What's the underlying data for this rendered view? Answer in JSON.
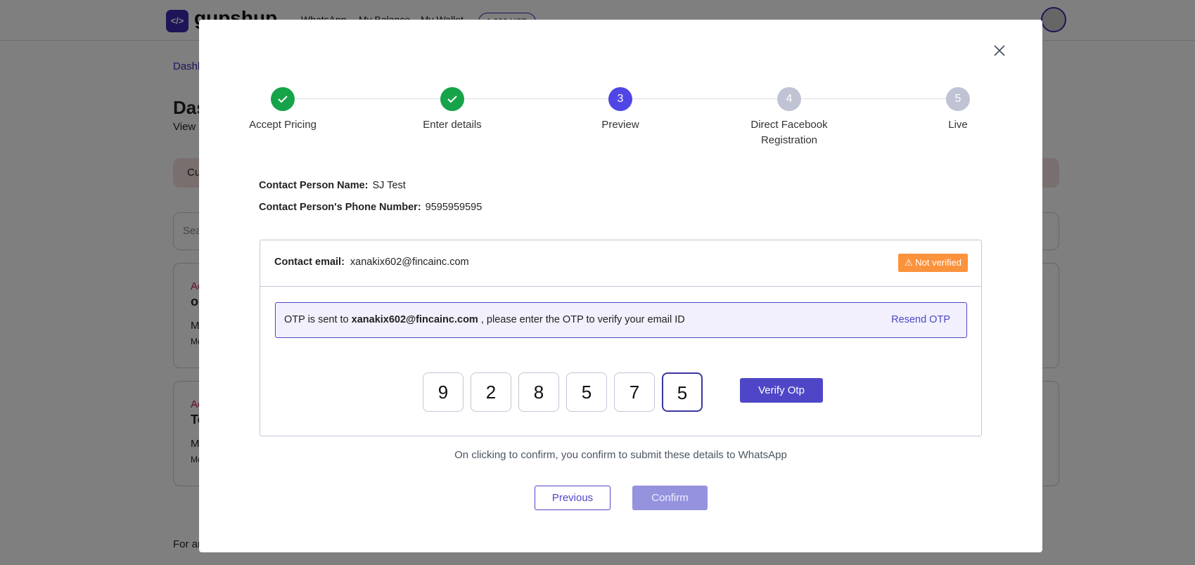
{
  "background": {
    "logo_text": "gupshup",
    "nav": [
      "WhatsApp",
      "My Balance",
      "My Wallet"
    ],
    "wallet_badge": "1,000 USD",
    "breadcrumb": "Dashb",
    "title": "Das",
    "subtitle": "View",
    "tab": "Cu",
    "search": "Sea",
    "card1": {
      "status": "Ac",
      "name": "o",
      "line1": "M",
      "line2": "Mo"
    },
    "card2": {
      "status": "Ac",
      "name": "Te",
      "line1": "M",
      "line2": "Mo"
    },
    "footer": "For ar"
  },
  "modal": {
    "steps": [
      {
        "label": "Accept Pricing",
        "state": "done"
      },
      {
        "label": "Enter details",
        "state": "done"
      },
      {
        "number": "3",
        "label": "Preview",
        "state": "active"
      },
      {
        "number": "4",
        "label": "Direct Facebook Registration",
        "state": "pending"
      },
      {
        "number": "5",
        "label": "Live",
        "state": "pending"
      }
    ],
    "contact_name_label": "Contact Person Name:",
    "contact_name": "SJ Test",
    "phone_label": "Contact Person's Phone Number:",
    "phone": "9595959595",
    "email_label": "Contact email:",
    "email": "xanakix602@fincainc.com",
    "email_status": "Not verified",
    "otp_msg_prefix": "OTP is sent to",
    "otp_msg_email": "xanakix602@fincainc.com",
    "otp_msg_suffix": ", please enter the OTP to verify your email ID",
    "resend_label": "Resend OTP",
    "otp_digits": [
      "9",
      "2",
      "8",
      "5",
      "7",
      "5"
    ],
    "verify_label": "Verify Otp",
    "note": "On clicking to confirm, you confirm to submit these details to WhatsApp",
    "previous_label": "Previous",
    "confirm_label": "Confirm"
  },
  "colors": {
    "accent": "#4f46c7",
    "success": "#16a34a",
    "pending": "#bfc3d4",
    "warning": "#fb923c"
  }
}
